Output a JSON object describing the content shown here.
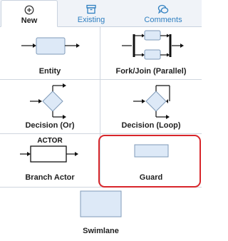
{
  "tabs": [
    {
      "label": "New",
      "icon": "add-circle-icon",
      "active": true
    },
    {
      "label": "Existing",
      "icon": "archive-box-icon",
      "active": false
    },
    {
      "label": "Comments",
      "icon": "comments-icon",
      "active": false
    }
  ],
  "palette": {
    "items": [
      {
        "label": "Entity",
        "icon": "entity-shape-icon"
      },
      {
        "label": "Fork/Join (Parallel)",
        "icon": "fork-join-shape-icon"
      },
      {
        "label": "Decision (Or)",
        "icon": "decision-or-shape-icon"
      },
      {
        "label": "Decision (Loop)",
        "icon": "decision-loop-shape-icon"
      },
      {
        "label": "Branch Actor",
        "icon": "branch-actor-shape-icon",
        "actor_text": "ACTOR"
      },
      {
        "label": "Guard",
        "icon": "guard-shape-icon",
        "selected": true
      },
      {
        "label": "Swimlane",
        "icon": "swimlane-shape-icon"
      }
    ]
  },
  "colors": {
    "accent": "#2f7fc0",
    "highlight": "#d8262b",
    "shape_fill": "#dde9f7",
    "shape_stroke": "#7f9ab8"
  }
}
